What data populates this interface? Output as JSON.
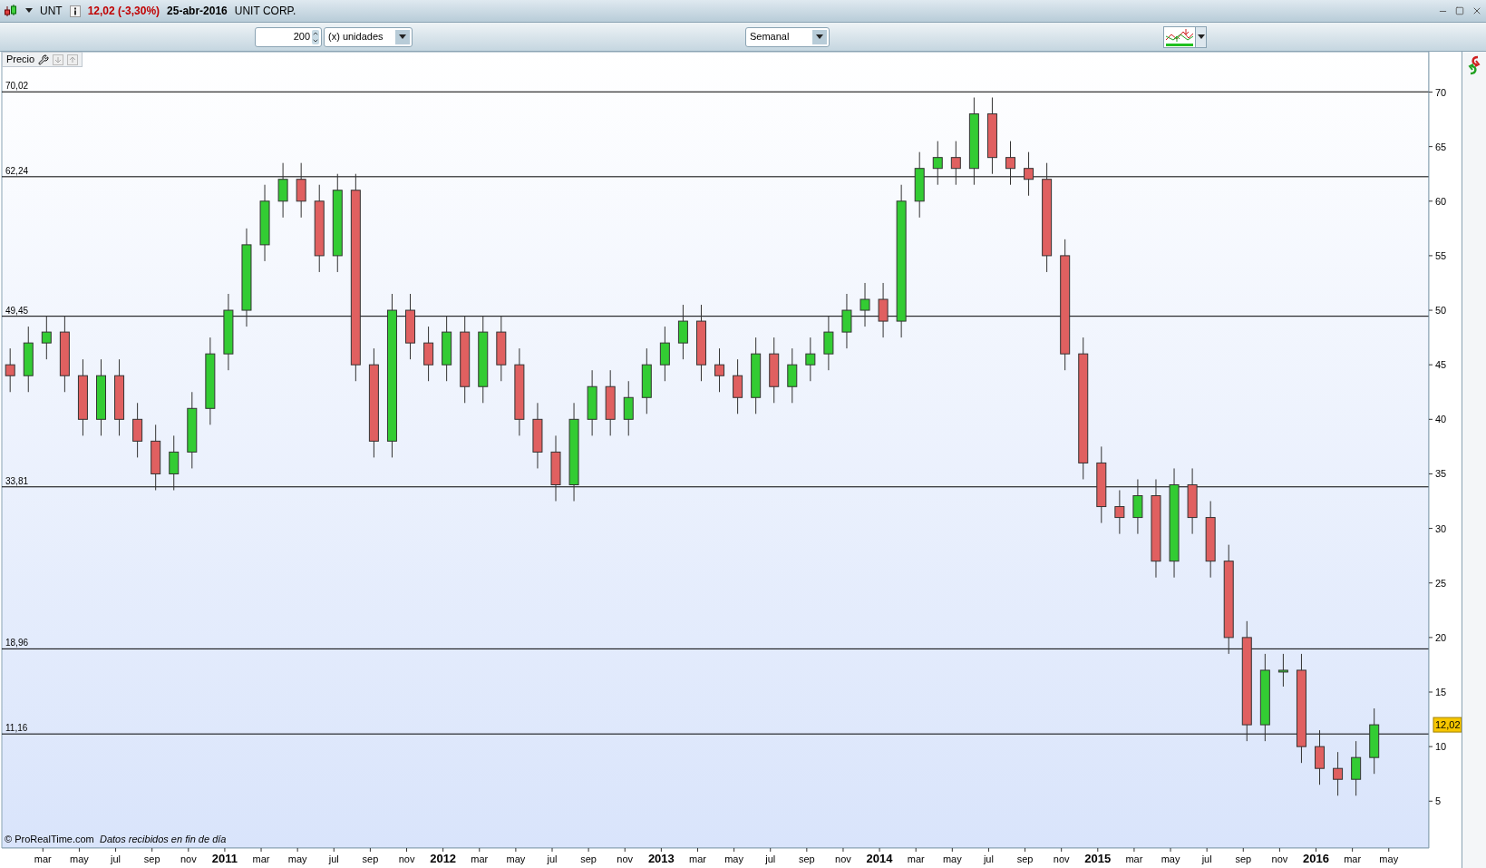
{
  "window": {
    "symbol": "UNT",
    "price_change": "12,02 (-3,30%)",
    "date": "25-abr-2016",
    "company": "UNIT CORP."
  },
  "toolbar": {
    "units_value": "200",
    "units_select": "(x) unidades",
    "period_select": "Semanal"
  },
  "panel": {
    "label": "Precio"
  },
  "chart": {
    "price_marker": "12,02",
    "chart_data": {
      "type": "candlestick",
      "categories": [
        null,
        null,
        "mar",
        null,
        "may",
        null,
        "jul",
        null,
        "sep",
        null,
        "nov",
        null,
        "2011",
        null,
        "mar",
        null,
        "may",
        null,
        "jul",
        null,
        "sep",
        null,
        "nov",
        null,
        "2012",
        null,
        "mar",
        null,
        "may",
        null,
        "jul",
        null,
        "sep",
        null,
        "nov",
        null,
        "2013",
        null,
        "mar",
        null,
        "may",
        null,
        "jul",
        null,
        "sep",
        null,
        "nov",
        null,
        "2014",
        null,
        "mar",
        null,
        "may",
        null,
        "jul",
        null,
        "sep",
        null,
        "nov",
        null,
        "2015",
        null,
        "mar",
        null,
        "may",
        null,
        "jul",
        null,
        "sep",
        null,
        "nov",
        null,
        "2016",
        null,
        "mar",
        null,
        "may"
      ],
      "ohlc": [
        [
          45,
          46.5,
          42.5,
          44
        ],
        [
          44,
          48.5,
          42.5,
          47
        ],
        [
          47,
          49.5,
          45.5,
          48
        ],
        [
          48,
          49.5,
          42.5,
          44
        ],
        [
          44,
          45.5,
          38.5,
          40
        ],
        [
          40,
          45.5,
          38.5,
          44
        ],
        [
          44,
          45.5,
          38.5,
          40
        ],
        [
          40,
          41.5,
          36.5,
          38
        ],
        [
          38,
          39.5,
          33.5,
          35
        ],
        [
          35,
          38.5,
          33.5,
          37
        ],
        [
          37,
          42.5,
          35.5,
          41
        ],
        [
          41,
          47.5,
          39.5,
          46
        ],
        [
          46,
          51.5,
          44.5,
          50
        ],
        [
          50,
          57.5,
          48.5,
          56
        ],
        [
          56,
          61.5,
          54.5,
          60
        ],
        [
          60,
          63.5,
          58.5,
          62
        ],
        [
          62,
          63.5,
          58.5,
          60
        ],
        [
          60,
          61.5,
          53.5,
          55
        ],
        [
          55,
          62.5,
          53.5,
          61
        ],
        [
          61,
          62.5,
          43.5,
          45
        ],
        [
          45,
          46.5,
          36.5,
          38
        ],
        [
          38,
          51.5,
          36.5,
          50
        ],
        [
          50,
          51.5,
          45.5,
          47
        ],
        [
          47,
          48.5,
          43.5,
          45
        ],
        [
          45,
          49.5,
          43.5,
          48
        ],
        [
          48,
          49.5,
          41.5,
          43
        ],
        [
          43,
          49.5,
          41.5,
          48
        ],
        [
          48,
          49.5,
          43.5,
          45
        ],
        [
          45,
          46.5,
          38.5,
          40
        ],
        [
          40,
          41.5,
          35.5,
          37
        ],
        [
          37,
          38.5,
          32.5,
          34
        ],
        [
          34,
          41.5,
          32.5,
          40
        ],
        [
          40,
          44.5,
          38.5,
          43
        ],
        [
          43,
          44.5,
          38.5,
          40
        ],
        [
          40,
          43.5,
          38.5,
          42
        ],
        [
          42,
          46.5,
          40.5,
          45
        ],
        [
          45,
          48.5,
          43.5,
          47
        ],
        [
          47,
          50.5,
          45.5,
          49
        ],
        [
          49,
          50.5,
          43.5,
          45
        ],
        [
          45,
          46.5,
          42.5,
          44
        ],
        [
          44,
          45.5,
          40.5,
          42
        ],
        [
          42,
          47.5,
          40.5,
          46
        ],
        [
          46,
          47.5,
          41.5,
          43
        ],
        [
          43,
          46.5,
          41.5,
          45
        ],
        [
          45,
          47.5,
          43.5,
          46
        ],
        [
          46,
          49.5,
          44.5,
          48
        ],
        [
          48,
          51.5,
          46.5,
          50
        ],
        [
          50,
          52.5,
          48.5,
          51
        ],
        [
          51,
          52.5,
          47.5,
          49
        ],
        [
          49,
          61.5,
          47.5,
          60
        ],
        [
          60,
          64.5,
          58.5,
          63
        ],
        [
          63,
          65.5,
          61.5,
          64
        ],
        [
          64,
          65.5,
          61.5,
          63
        ],
        [
          63,
          69.5,
          61.5,
          68
        ],
        [
          68,
          69.5,
          62.5,
          64
        ],
        [
          64,
          65.5,
          61.5,
          63
        ],
        [
          63,
          64.5,
          60.5,
          62
        ],
        [
          62,
          63.5,
          53.5,
          55
        ],
        [
          55,
          56.5,
          44.5,
          46
        ],
        [
          46,
          47.5,
          34.5,
          36
        ],
        [
          36,
          37.5,
          30.5,
          32
        ],
        [
          32,
          33.5,
          29.5,
          31
        ],
        [
          31,
          34.5,
          29.5,
          33
        ],
        [
          33,
          34.5,
          25.5,
          27
        ],
        [
          27,
          35.5,
          25.5,
          34
        ],
        [
          34,
          35.5,
          29.5,
          31
        ],
        [
          31,
          32.5,
          25.5,
          27
        ],
        [
          27,
          28.5,
          18.5,
          20
        ],
        [
          20,
          21.5,
          10.5,
          12
        ],
        [
          12,
          18.5,
          10.5,
          17
        ],
        [
          17,
          18.5,
          15.5,
          17
        ],
        [
          17,
          18.5,
          8.5,
          10
        ],
        [
          10,
          11.5,
          6.5,
          8
        ],
        [
          8,
          9.5,
          5.5,
          7
        ],
        [
          7,
          10.5,
          5.5,
          9
        ],
        [
          9,
          13.5,
          7.5,
          12
        ],
        null
      ],
      "ylim": [
        0.7,
        73.7
      ],
      "yticks": [
        5,
        10,
        15,
        20,
        25,
        30,
        35,
        40,
        45,
        50,
        55,
        60,
        65,
        70
      ]
    },
    "level_lines": [
      "70,02",
      "62,24",
      "49,45",
      "33,81",
      "18,96",
      "11,16"
    ]
  },
  "footer": {
    "copyright": "© ProRealTime.com",
    "note": "Datos recibidos en fin de día"
  }
}
